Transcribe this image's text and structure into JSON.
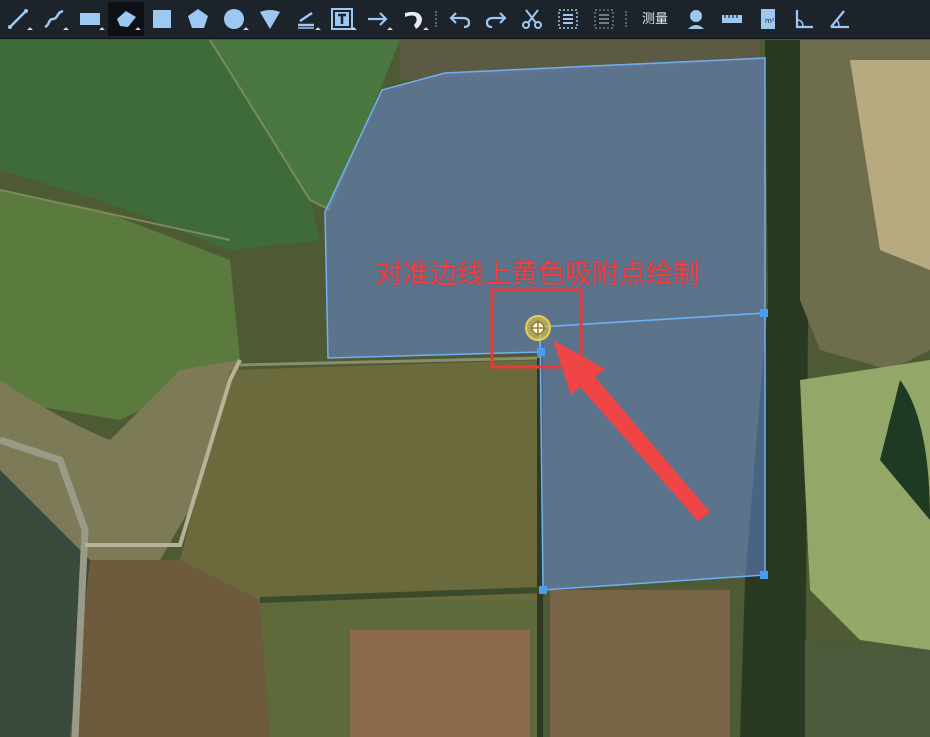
{
  "toolbar": {
    "measure_label": "测量",
    "icon_color": "#9cc8f2",
    "tools": [
      "polyline-icon",
      "freehand-line-icon",
      "rectangle-icon",
      "freehand-polygon-icon",
      "square-icon",
      "pentagon-icon",
      "circle-icon",
      "sector-icon",
      "parallel-line-icon",
      "text-icon",
      "arrow-icon",
      "curved-arrow-icon",
      "undo-icon",
      "redo-icon",
      "cut-icon",
      "select-all-icon",
      "deselect-icon",
      "location-pin-icon",
      "ruler-icon",
      "area-measure-icon",
      "angle-icon",
      "azimuth-icon"
    ]
  },
  "map": {
    "annotation_text": "对准边线上黄色吸附点绘制",
    "annotation_color": "#ff3a3a",
    "polygon_fill": "rgba(108, 140, 228, 0.5)",
    "polygon_stroke": "#6fb0f2",
    "snap_point_color": "#e8d24a"
  }
}
